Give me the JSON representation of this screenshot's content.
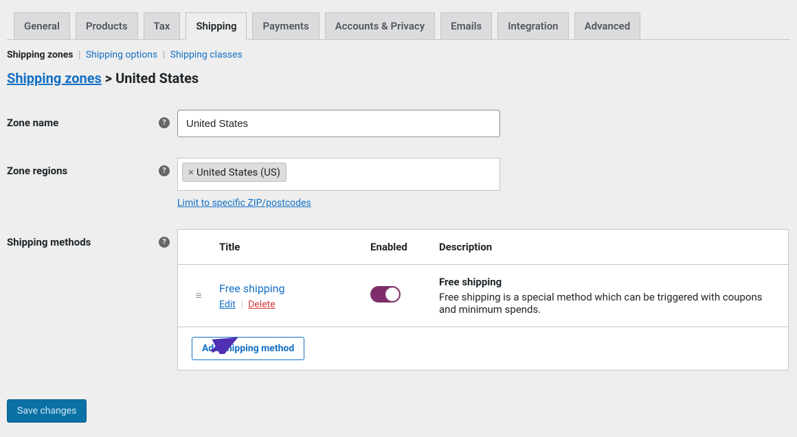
{
  "tabs": {
    "general": "General",
    "products": "Products",
    "tax": "Tax",
    "shipping": "Shipping",
    "payments": "Payments",
    "accounts": "Accounts & Privacy",
    "emails": "Emails",
    "integration": "Integration",
    "advanced": "Advanced"
  },
  "subnav": {
    "zones": "Shipping zones",
    "options": "Shipping options",
    "classes": "Shipping classes"
  },
  "breadcrumb": {
    "parent": "Shipping zones",
    "separator": " > ",
    "current": "United States"
  },
  "fields": {
    "zone_name_label": "Zone name",
    "zone_name_value": "United States",
    "zone_regions_label": "Zone regions",
    "zone_regions_tag": "United States (US)",
    "limit_link": "Limit to specific ZIP/postcodes",
    "shipping_methods_label": "Shipping methods"
  },
  "methods_table": {
    "col_title": "Title",
    "col_enabled": "Enabled",
    "col_description": "Description",
    "rows": [
      {
        "title": "Free shipping",
        "edit_label": "Edit",
        "delete_label": "Delete",
        "enabled": true,
        "desc_title": "Free shipping",
        "desc_body": "Free shipping is a special method which can be triggered with coupons and minimum spends."
      }
    ],
    "add_button": "Add shipping method"
  },
  "save_button": "Save changes"
}
